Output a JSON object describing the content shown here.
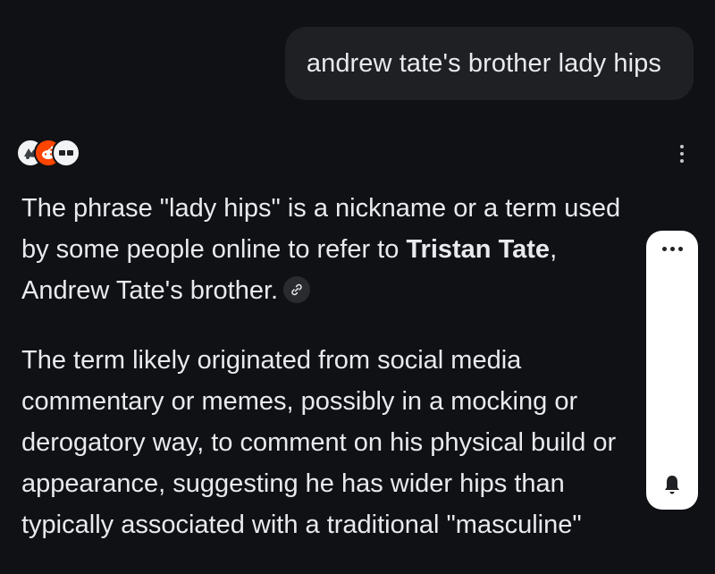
{
  "user_query": "andrew tate's brother lady hips",
  "sources": [
    {
      "icon": "source-site-icon"
    },
    {
      "icon": "reddit-icon"
    },
    {
      "icon": "source-logo-icon"
    }
  ],
  "answer": {
    "p1_before": "The phrase \"lady hips\" is a nickname or a term used by some people online to refer to ",
    "p1_bold": "Tristan Tate",
    "p1_after": ", Andrew Tate's brother.",
    "p2": "The term likely originated from social media commentary or memes, possibly in a mocking or derogatory way, to comment on his physical build or appearance, suggesting he has wider hips than typically associated with a traditional \"masculine\""
  },
  "icons": {
    "link": "link-icon",
    "more": "more-vert-icon",
    "panel_more": "more-horiz-icon",
    "bell": "bell-icon"
  },
  "colors": {
    "background": "#101114",
    "bubble": "#1f2024",
    "text": "#e8eaed",
    "panel": "#ffffff",
    "reddit": "#ff4500"
  }
}
